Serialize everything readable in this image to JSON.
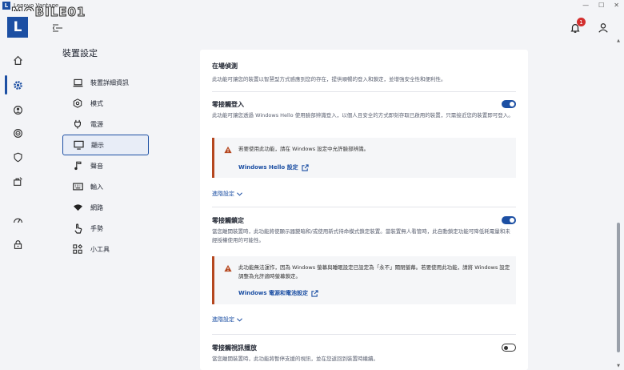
{
  "window": {
    "app_title": "Lenovo Vantage",
    "app_icon_letter": "L",
    "watermark_text": "MOBILE01"
  },
  "rail": {
    "logo_letter": "L",
    "items": [
      "home-icon",
      "gear-icon",
      "support-icon",
      "wifi-security-icon",
      "shield-icon",
      "toolbox-icon",
      "gauge-icon",
      "lock-icon"
    ],
    "active_item": "gear-icon"
  },
  "header": {
    "notification_count": "1"
  },
  "settings": {
    "page_title": "裝置設定",
    "nav": [
      {
        "label": "裝置詳細資訊",
        "icon": "laptop-icon"
      },
      {
        "label": "模式",
        "icon": "mode-icon"
      },
      {
        "label": "電源",
        "icon": "plug-icon"
      },
      {
        "label": "顯示",
        "icon": "monitor-icon"
      },
      {
        "label": "聲音",
        "icon": "music-note-icon"
      },
      {
        "label": "輸入",
        "icon": "keyboard-icon"
      },
      {
        "label": "網路",
        "icon": "wifi-icon"
      },
      {
        "label": "手勢",
        "icon": "hand-icon"
      },
      {
        "label": "小工具",
        "icon": "widgets-icon"
      }
    ],
    "selected_nav": "顯示"
  },
  "content": {
    "section_title": "在場偵測",
    "section_desc": "此功能可讓您的裝置以智慧型方式感應到您的存在，提供順暢的登入和鎖定，並增強安全性和便利性。",
    "zero_touch_login": {
      "title": "零接觸登入",
      "desc": "此功能可讓您透過 Windows Hello 使用臉部辨識登入，以個人且安全的方式即刻存取已啟用的裝置，只需接近您的裝置即可登入。",
      "toggle_on": true,
      "warning": "若要使用此功能，請在 Windows 設定中允許臉部辨識。",
      "link": "Windows Hello 設定",
      "advanced": "進階設定"
    },
    "zero_touch_lock": {
      "title": "零接觸鎖定",
      "desc": "當您離開裝置時，此功能將使顯示器變暗和/或使用新式待命模式鎖定裝置。當裝置無人看管時，此自動鎖定功能可降低耗電量和未經授權使用的可能性。",
      "toggle_on": true,
      "warning": "此功能無法運作，因為 Windows 螢幕與睡眠設定已設定為「永不」關閉螢幕。若要使用此功能，請將 Windows 設定調整為允許適時螢幕鎖定。",
      "link": "Windows 電源和電池設定",
      "advanced": "進階設定"
    },
    "zero_touch_video": {
      "title": "零接觸視訊播放",
      "desc": "當您離開裝置時，此功能將暫停支援的視訊，並在您返回到裝置時繼續。",
      "toggle_on": false
    }
  },
  "colors": {
    "accent": "#1c4fa3",
    "warning": "#b5471f",
    "badge": "#d32f2f"
  }
}
